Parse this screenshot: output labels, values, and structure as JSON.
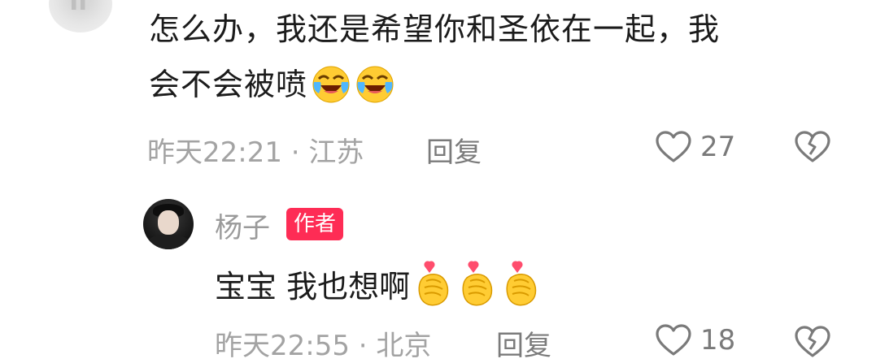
{
  "comment": {
    "text_line1": "怎么办，我还是希望你和圣依在一起，我",
    "text_line2": "会不会被喷",
    "emojis": [
      "laugh-crying-emoji",
      "laugh-crying-emoji"
    ],
    "meta": "昨天22:21 · 江苏",
    "reply_label": "回复",
    "likes": "27",
    "icons": {
      "like": "heart-outline-icon",
      "dislike": "broken-heart-icon"
    }
  },
  "reply": {
    "author": "杨子",
    "badge": "作者",
    "text": "宝宝 我也想啊",
    "emojis": [
      "finger-heart-emoji",
      "finger-heart-emoji",
      "finger-heart-emoji"
    ],
    "meta": "昨天22:55 · 北京",
    "reply_label": "回复",
    "likes": "18"
  },
  "colors": {
    "badge_bg": "#fe2c55",
    "meta_text": "#a3a3a3",
    "main_text": "#1b1b1b",
    "emoji_yellow": "#ffcc33"
  }
}
